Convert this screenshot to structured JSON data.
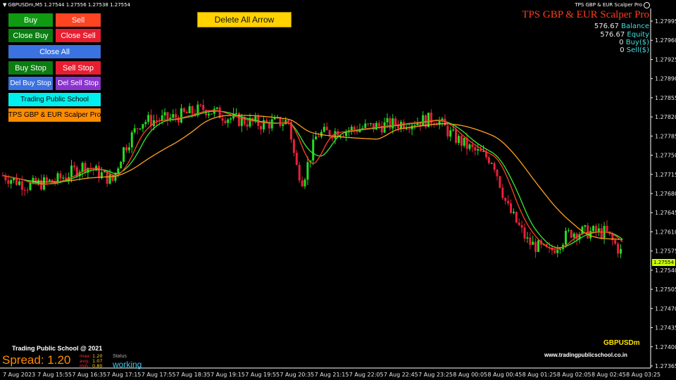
{
  "header": {
    "symbol_info": "GBPUSDm,M5  1.27544 1.27556 1.27538 1.27554",
    "ea_short": "TPS GBP & EUR Scalper Pro"
  },
  "buttons": {
    "buy": "Buy",
    "sell": "Sell",
    "close_buy": "Close Buy",
    "close_sell": "Close Sell",
    "close_all": "Close All",
    "buy_stop": "Buy Stop",
    "sell_stop": "Sell Stop",
    "del_buy_stop": "Del Buy Stop",
    "del_sell_stop": "Del Sell Stop",
    "trading_public_school": "Trading Public School",
    "tps_scalper": "TPS GBP & EUR Scalper Pro",
    "delete_all_arrow": "Delete All Arrow"
  },
  "account": {
    "title": "TPS GBP & EUR Scalper Pro",
    "balance_value": "576.67",
    "balance_label": "Balance",
    "equity_value": "576.67",
    "equity_label": "Equity",
    "buy_value": "0",
    "buy_label": "Buy($)",
    "sell_value": "0",
    "sell_label": "Sell($)"
  },
  "footer": {
    "brand": "Trading Public School @ 2021",
    "spread_text": "Spread: 1.20",
    "stats": [
      {
        "k": "max:",
        "v": "1.20"
      },
      {
        "k": "avg:",
        "v": "1.07"
      },
      {
        "k": "min:",
        "v": "0.80"
      }
    ],
    "status_label": "Status",
    "status_value": "working",
    "symbol": "GBPUSDm",
    "website": "www.tradingpublicschool.co.in"
  },
  "current_price": "1.27554",
  "price_axis": [
    "1.27995",
    "1.27960",
    "1.27925",
    "1.27890",
    "1.27855",
    "1.27820",
    "1.27785",
    "1.27750",
    "1.27715",
    "1.27680",
    "1.27645",
    "1.27610",
    "1.27575",
    "1.27540",
    "1.27505",
    "1.27470",
    "1.27435",
    "1.27400",
    "1.27365"
  ],
  "time_axis": [
    "7 Aug 2023",
    "7 Aug 15:55",
    "7 Aug 16:35",
    "7 Aug 17:15",
    "7 Aug 17:55",
    "7 Aug 18:35",
    "7 Aug 19:15",
    "7 Aug 19:55",
    "7 Aug 20:35",
    "7 Aug 21:15",
    "7 Aug 22:05",
    "7 Aug 22:45",
    "7 Aug 23:25",
    "8 Aug 00:05",
    "8 Aug 00:45",
    "8 Aug 01:25",
    "8 Aug 02:05",
    "8 Aug 02:45",
    "8 Aug 03:25"
  ],
  "colors": {
    "bull": "#22dd22",
    "bear": "#e8203a",
    "ma_red": "#ff4422",
    "ma_green": "#33ee33",
    "ma_orange": "#ffa020",
    "ma_blue": "#2244ff"
  },
  "chart_data": {
    "type": "candlestick",
    "symbol": "GBPUSDm",
    "timeframe": "M5",
    "ylim": [
      1.2735,
      1.2801
    ],
    "last": 1.27554
  }
}
